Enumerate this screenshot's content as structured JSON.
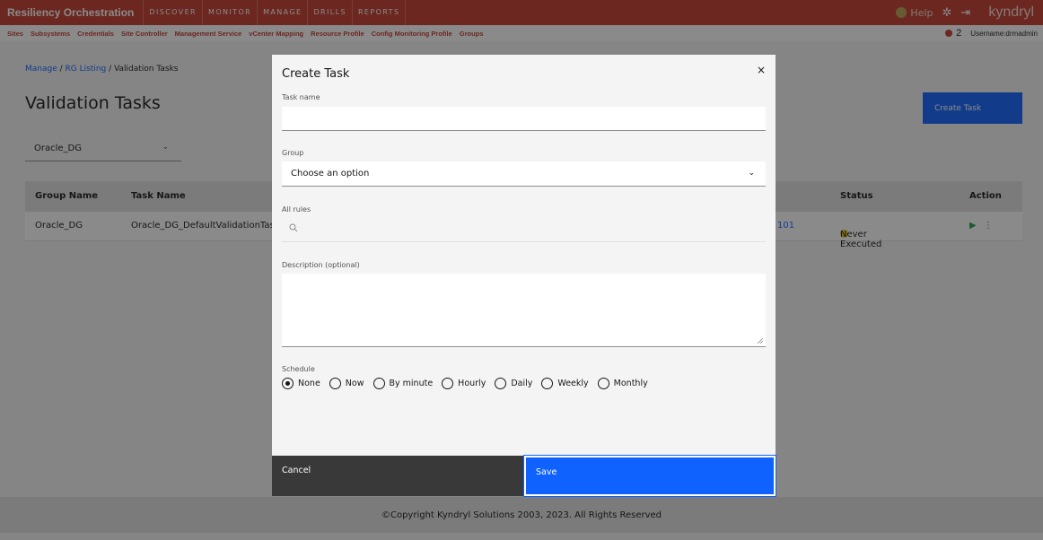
{
  "header": {
    "brand": "Resiliency Orchestration",
    "nav": [
      "DISCOVER",
      "MONITOR",
      "MANAGE",
      "DRILLS",
      "REPORTS"
    ],
    "help": "Help",
    "logo": "kyndryl"
  },
  "subnav": {
    "items": [
      "Sites",
      "Subsystems",
      "Credentials",
      "Site Controller",
      "Management Service",
      "vCenter Mapping",
      "Resource Profile",
      "Config Monitoring Profile",
      "Groups"
    ],
    "alert_count": "2",
    "username": "Username:drmadmin"
  },
  "page": {
    "breadcrumb": [
      "Manage",
      "RG Listing",
      "Validation Tasks"
    ],
    "title": "Validation Tasks",
    "group_select": "Oracle_DG",
    "create_button": "Create Task",
    "table": {
      "columns": [
        "Group Name",
        "Task Name",
        "Status",
        "Action"
      ],
      "rows": [
        {
          "group": "Oracle_DG",
          "task": "Oracle_DG_DefaultValidationTask",
          "partial": "101",
          "status": "Never Executed"
        }
      ]
    }
  },
  "modal": {
    "title": "Create Task",
    "close": "×",
    "task_name_label": "Task name",
    "task_name_value": "",
    "group_label": "Group",
    "group_value": "Choose an option",
    "rules_label": "All rules",
    "description_label": "Description (optional)",
    "schedule_label": "Schedule",
    "schedule_options": [
      "None",
      "Now",
      "By minute",
      "Hourly",
      "Daily",
      "Weekly",
      "Monthly"
    ],
    "schedule_selected": "None",
    "cancel": "Cancel",
    "save": "Save"
  },
  "footer": "©Copyright Kyndryl Solutions 2003, 2023. All Rights Reserved"
}
